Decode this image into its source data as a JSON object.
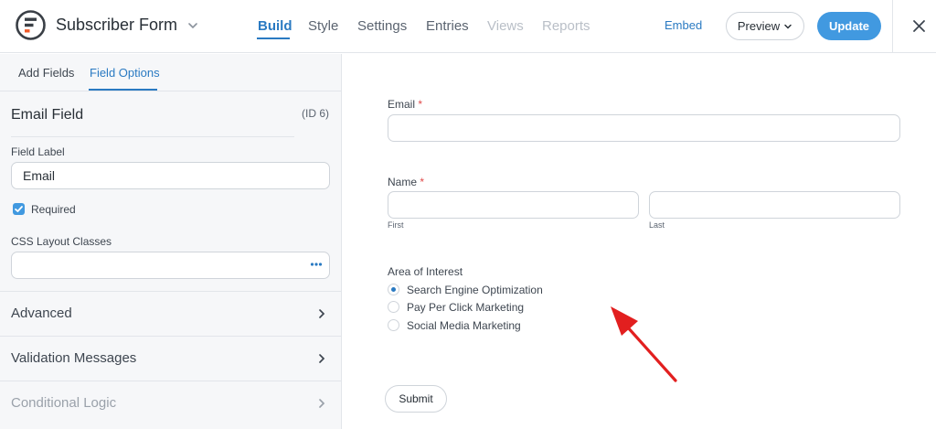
{
  "header": {
    "form_title": "Subscriber Form",
    "tabs": [
      {
        "label": "Build",
        "state": "active"
      },
      {
        "label": "Style",
        "state": "normal"
      },
      {
        "label": "Settings",
        "state": "normal"
      },
      {
        "label": "Entries",
        "state": "normal"
      },
      {
        "label": "Views",
        "state": "disabled"
      },
      {
        "label": "Reports",
        "state": "disabled"
      }
    ],
    "embed_label": "Embed",
    "preview_label": "Preview",
    "update_label": "Update",
    "accent_color": "#4199e0"
  },
  "sidebar": {
    "tabs": [
      {
        "label": "Add Fields"
      },
      {
        "label": "Field Options",
        "active": true
      }
    ],
    "field_heading": "Email Field",
    "field_id": "(ID 6)",
    "field_label_caption": "Field Label",
    "field_label_value": "Email",
    "required_label": "Required",
    "required_checked": true,
    "css_classes_caption": "CSS Layout Classes",
    "css_classes_value": "",
    "sections": [
      {
        "label": "Advanced",
        "enabled": true
      },
      {
        "label": "Validation Messages",
        "enabled": true
      },
      {
        "label": "Conditional Logic",
        "enabled": false
      }
    ]
  },
  "form": {
    "email_label": "Email",
    "name_label": "Name",
    "required_marker": "*",
    "first_sublabel": "First",
    "last_sublabel": "Last",
    "interest_label": "Area of Interest",
    "interest_options": [
      {
        "label": "Search Engine Optimization",
        "selected": true
      },
      {
        "label": "Pay Per Click Marketing",
        "selected": false
      },
      {
        "label": "Social Media Marketing",
        "selected": false
      }
    ],
    "submit_label": "Submit"
  },
  "annotation": {
    "arrow_color": "#e21f1f"
  }
}
